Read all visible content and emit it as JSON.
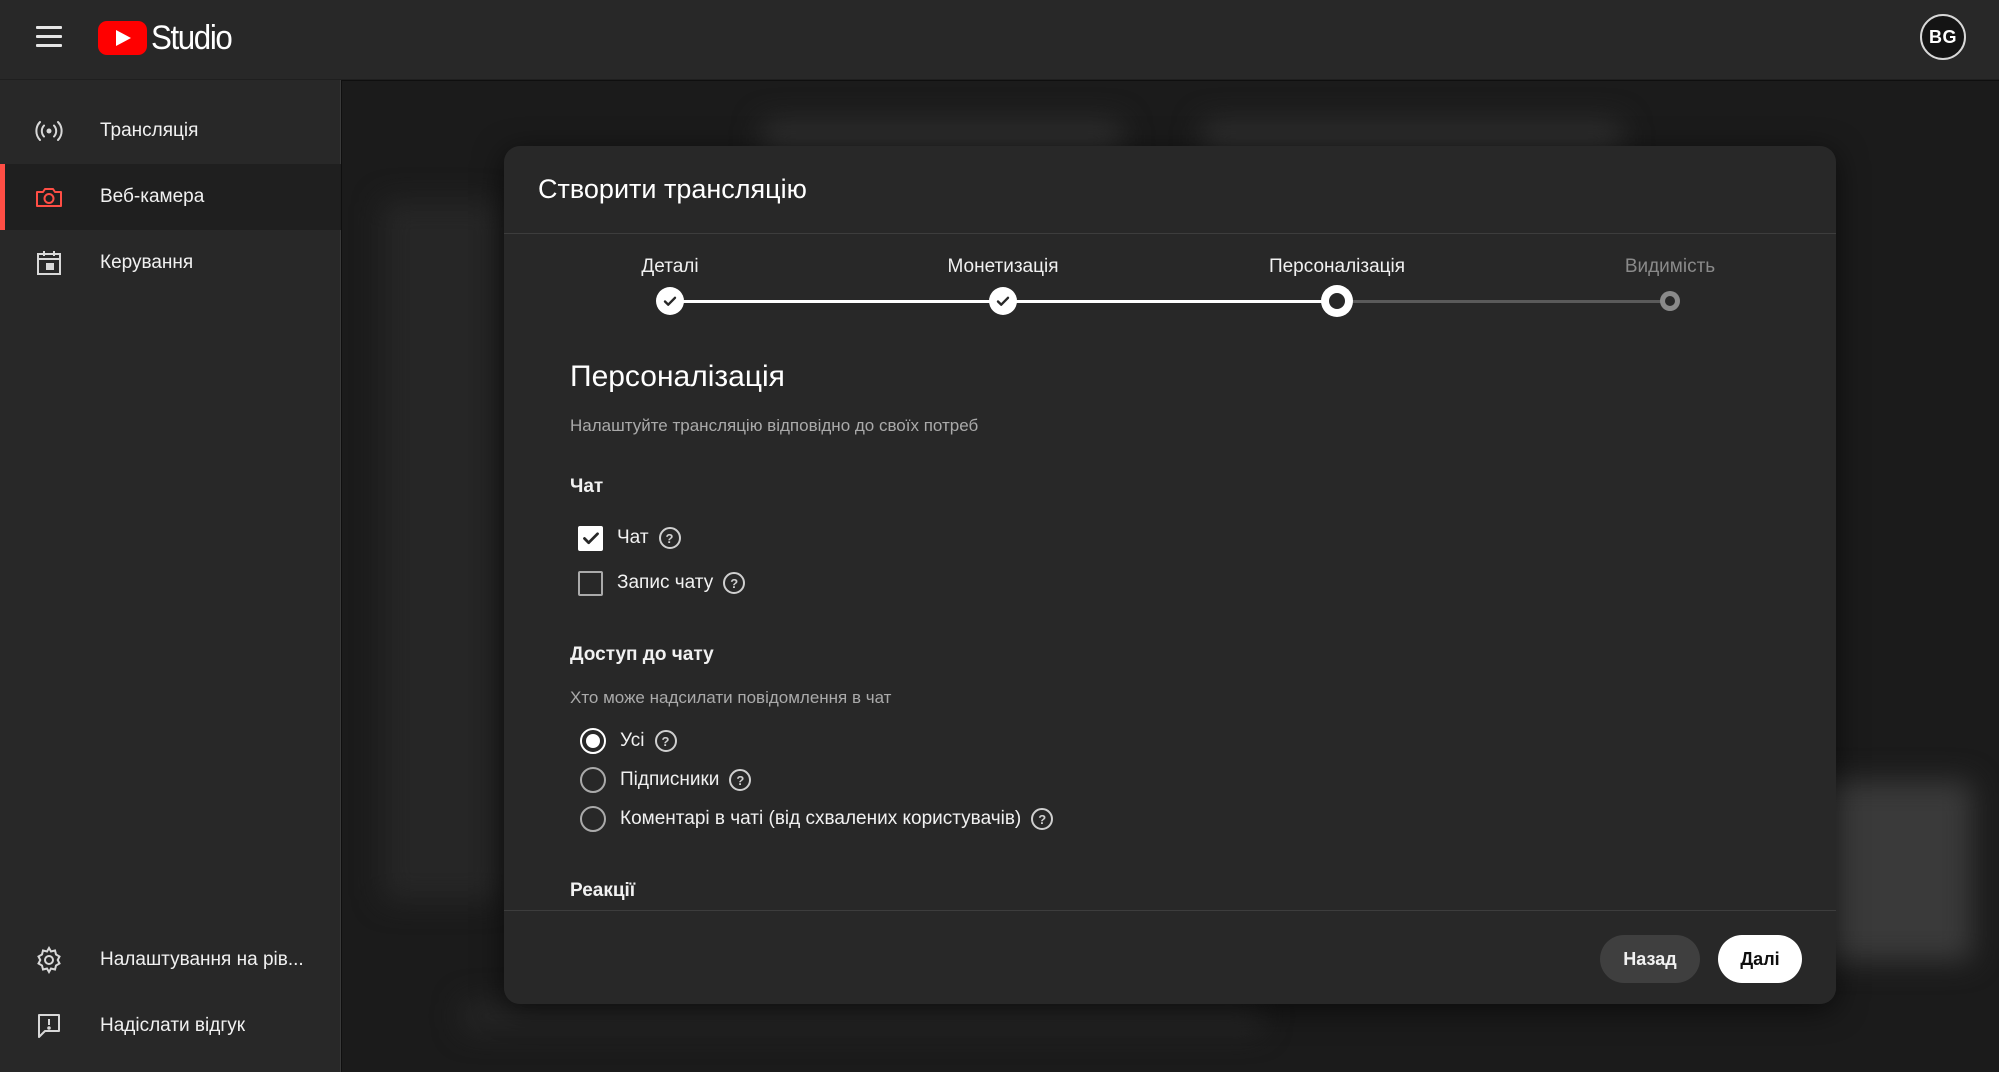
{
  "app": {
    "logo_text": "Studio",
    "avatar_initials": "BG"
  },
  "sidebar": {
    "items": [
      {
        "label": "Трансляція",
        "icon": "broadcast-icon"
      },
      {
        "label": "Веб-камера",
        "icon": "camera-icon",
        "active": true
      },
      {
        "label": "Керування",
        "icon": "calendar-icon"
      }
    ],
    "bottom_items": [
      {
        "label": "Налаштування на рів...",
        "icon": "gear-icon"
      },
      {
        "label": "Надіслати відгук",
        "icon": "feedback-icon"
      }
    ]
  },
  "modal": {
    "title": "Створити трансляцію",
    "steps": [
      {
        "label": "Деталі",
        "state": "done"
      },
      {
        "label": "Монетизація",
        "state": "done"
      },
      {
        "label": "Персоналізація",
        "state": "current"
      },
      {
        "label": "Видимість",
        "state": "future"
      }
    ],
    "section_title": "Персоналізація",
    "section_subtitle": "Налаштуйте трансляцію відповідно до своїх потреб",
    "chat": {
      "title": "Чат",
      "options": [
        {
          "label": "Чат",
          "checked": true
        },
        {
          "label": "Запис чату",
          "checked": false
        }
      ]
    },
    "chat_access": {
      "title": "Доступ до чату",
      "subtitle": "Хто може надсилати повідомлення в чат",
      "options": [
        {
          "label": "Усі",
          "selected": true
        },
        {
          "label": "Підписники",
          "selected": false
        },
        {
          "label": "Коментарі в чаті (від схвалених користувачів)",
          "selected": false
        }
      ]
    },
    "reactions_title": "Реакції",
    "buttons": {
      "back": "Назад",
      "next": "Далі"
    },
    "help_glyph": "?"
  },
  "colors": {
    "accent_red": "#ff0000",
    "active_marker": "#ff4e45",
    "surface": "#282828"
  }
}
